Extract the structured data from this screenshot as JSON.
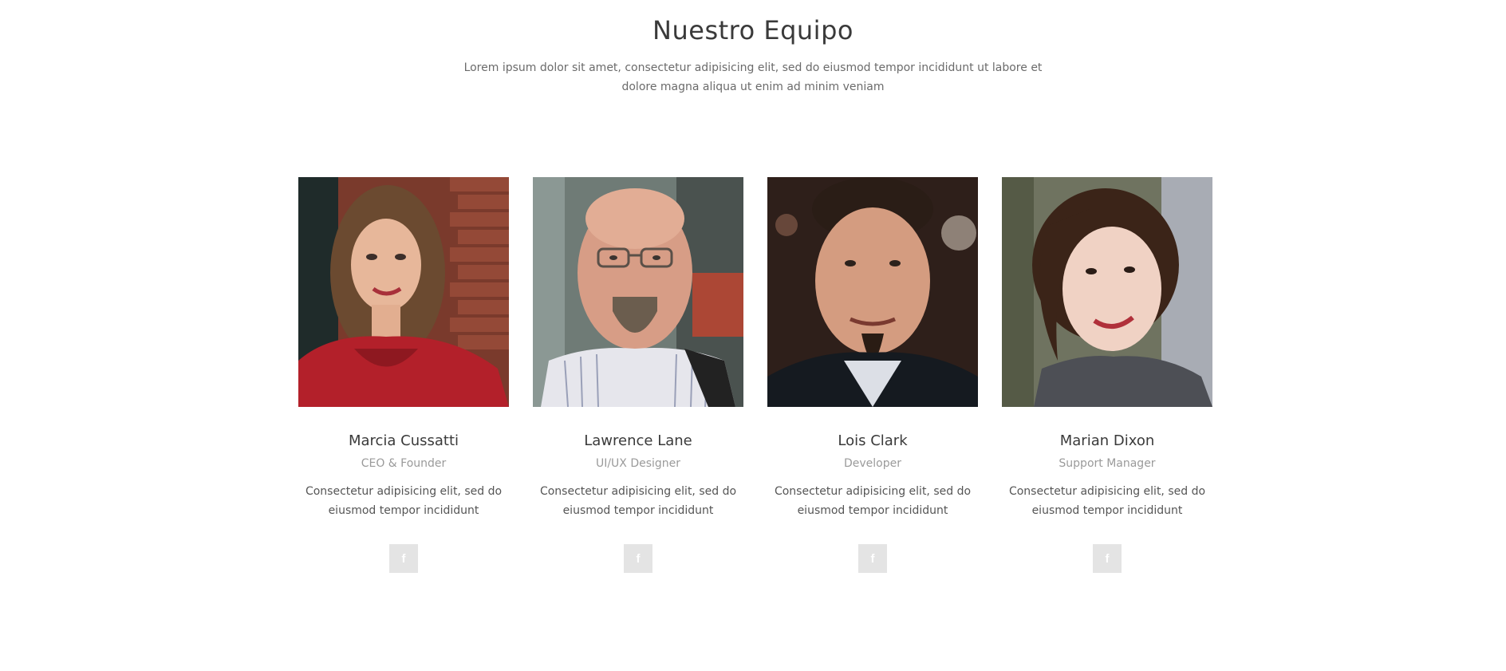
{
  "section": {
    "title": "Nuestro Equipo",
    "subtitle": "Lorem ipsum dolor sit amet, consectetur adipisicing elit, sed do eiusmod tempor incididunt ut labore et dolore magna aliqua ut enim ad minim veniam"
  },
  "team": [
    {
      "name": "Marcia Cussatti",
      "role": "CEO & Founder",
      "description": "Consectetur adipisicing elit, sed do eiusmod tempor incididunt",
      "social_icon": "facebook-icon",
      "social_glyph": "f"
    },
    {
      "name": "Lawrence Lane",
      "role": "UI/UX Designer",
      "description": "Consectetur adipisicing elit, sed do eiusmod tempor incididunt",
      "social_icon": "facebook-icon",
      "social_glyph": "f"
    },
    {
      "name": "Lois Clark",
      "role": "Developer",
      "description": "Consectetur adipisicing elit, sed do eiusmod tempor incididunt",
      "social_icon": "facebook-icon",
      "social_glyph": "f"
    },
    {
      "name": "Marian Dixon",
      "role": "Support Manager",
      "description": "Consectetur adipisicing elit, sed do eiusmod tempor incididunt",
      "social_icon": "facebook-icon",
      "social_glyph": "f"
    }
  ],
  "colors": {
    "title": "#3a3a3a",
    "subtitle": "#6b6b6b",
    "role": "#9a9a9a",
    "social_button_bg": "#e4e4e4"
  }
}
